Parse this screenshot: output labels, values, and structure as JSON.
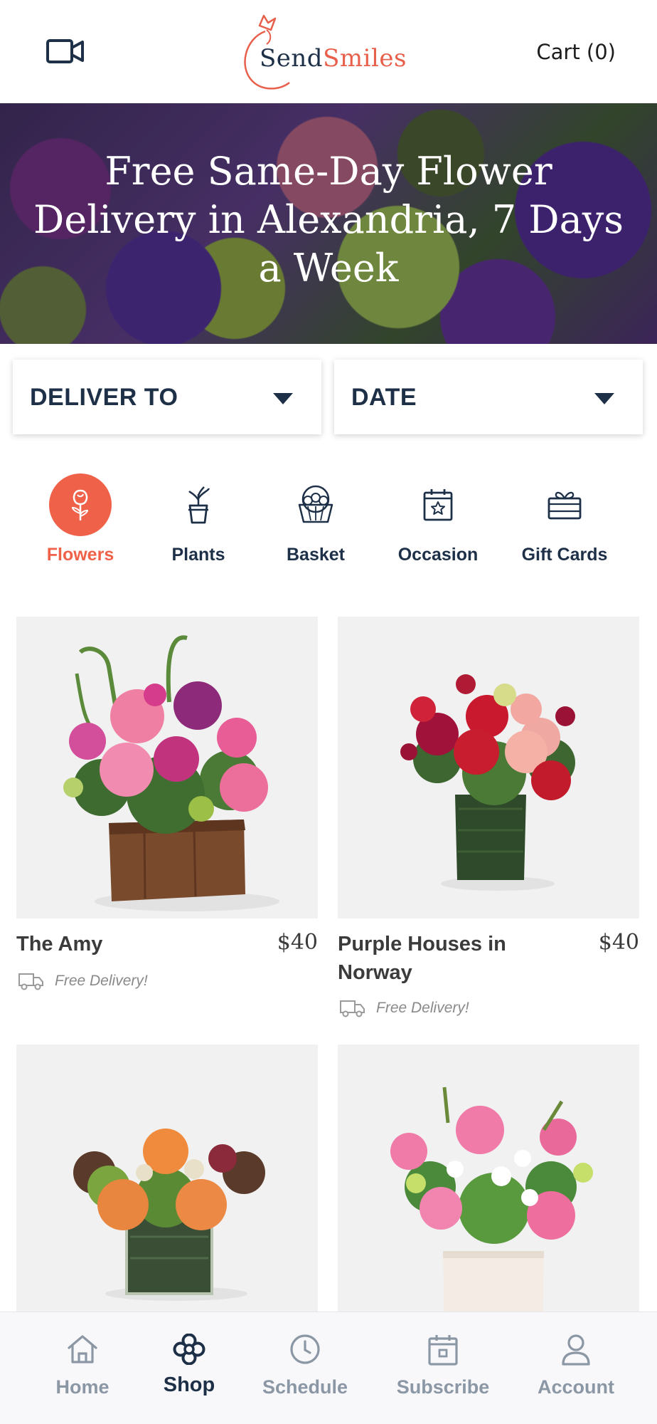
{
  "header": {
    "logo_part1": "Send",
    "logo_part2": "Smiles",
    "cart_label": "Cart (0)"
  },
  "hero": {
    "title": "Free Same-Day Flower Delivery in Alexandria, 7 Days a Week"
  },
  "selectors": {
    "deliver_to": "DELIVER TO",
    "date": "DATE"
  },
  "categories": [
    {
      "label": "Flowers",
      "icon": "rose-icon",
      "active": true
    },
    {
      "label": "Plants",
      "icon": "potted-plant-icon",
      "active": false
    },
    {
      "label": "Basket",
      "icon": "basket-icon",
      "active": false
    },
    {
      "label": "Occasion",
      "icon": "calendar-star-icon",
      "active": false
    },
    {
      "label": "Gift Cards",
      "icon": "gift-icon",
      "active": false
    }
  ],
  "products": [
    {
      "name": "The Amy",
      "price": "$40",
      "delivery": "Free Delivery!"
    },
    {
      "name": "Purple Houses in Norway",
      "price": "$40",
      "delivery": "Free Delivery!"
    },
    {
      "name": "",
      "price": "",
      "delivery": ""
    },
    {
      "name": "",
      "price": "",
      "delivery": ""
    }
  ],
  "nav": {
    "items": [
      {
        "label": "Home",
        "icon": "home-icon",
        "active": false
      },
      {
        "label": "Shop",
        "icon": "flower-icon",
        "active": true
      },
      {
        "label": "Schedule",
        "icon": "clock-icon",
        "active": false
      },
      {
        "label": "Subscribe",
        "icon": "calendar-icon",
        "active": false
      },
      {
        "label": "Account",
        "icon": "user-icon",
        "active": false
      }
    ]
  },
  "colors": {
    "brand_coral": "#f0614a",
    "navy": "#1d3047",
    "nav_inactive": "#8b97a5"
  }
}
